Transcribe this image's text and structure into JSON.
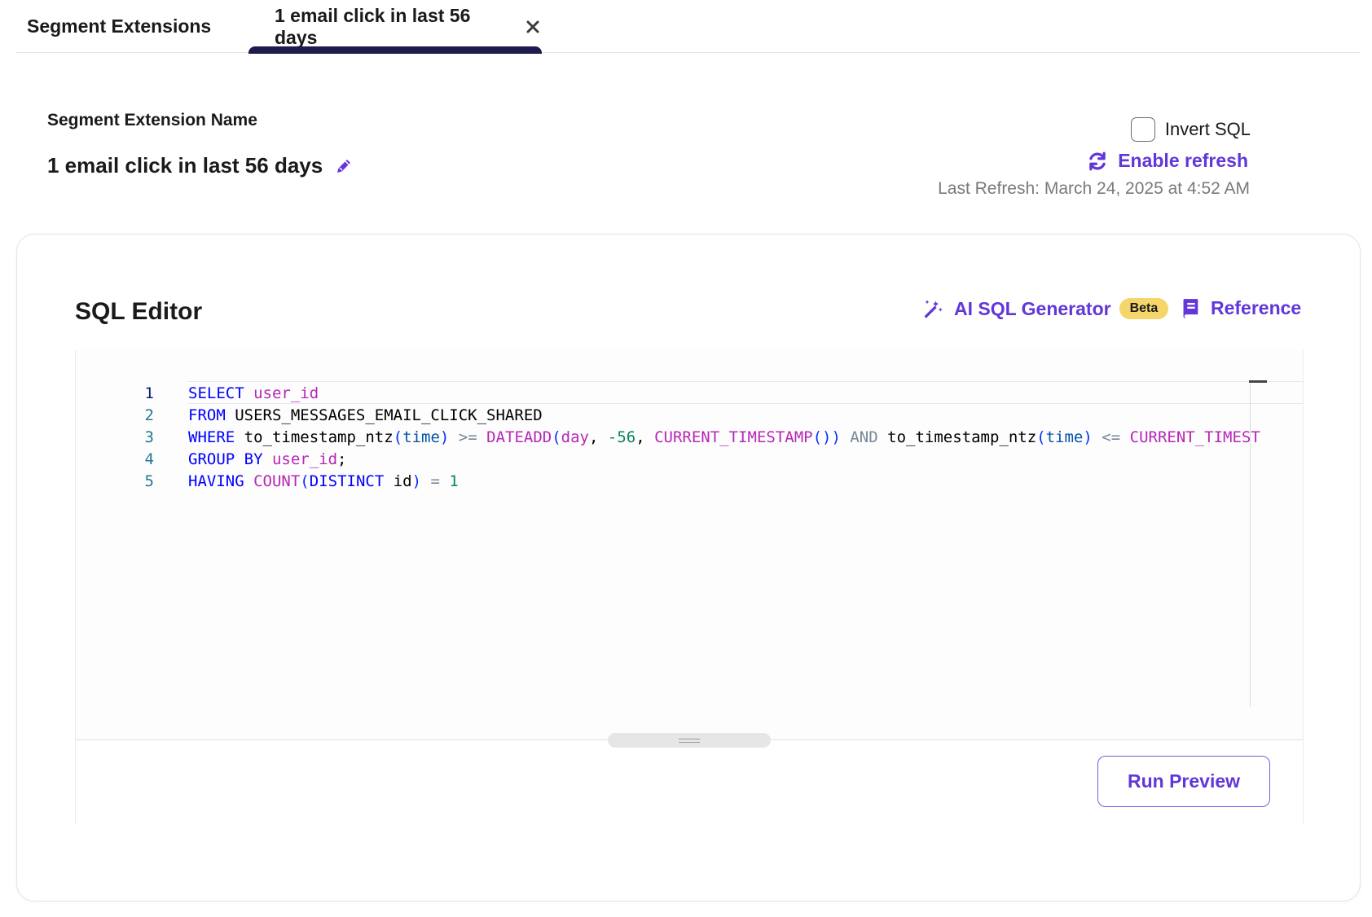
{
  "tabs": [
    {
      "label": "Segment Extensions"
    },
    {
      "label": "1 email click in last 56 days",
      "active": true
    }
  ],
  "header": {
    "name_label": "Segment Extension Name",
    "name_value": "1 email click in last 56 days",
    "invert_sql_label": "Invert SQL",
    "invert_sql_checked": false,
    "enable_refresh_label": "Enable refresh",
    "last_refresh": "Last Refresh: March 24, 2025 at 4:52 AM"
  },
  "editor": {
    "title": "SQL Editor",
    "ai_generator_label": "AI SQL Generator",
    "beta_badge": "Beta",
    "reference_label": "Reference",
    "line_numbers": [
      "1",
      "2",
      "3",
      "4",
      "5"
    ],
    "lines": [
      "SELECT user_id",
      "FROM USERS_MESSAGES_EMAIL_CLICK_SHARED",
      "WHERE to_timestamp_ntz(time) >= DATEADD(day, -56, CURRENT_TIMESTAMP()) AND to_timestamp_ntz(time) <= CURRENT_TIMEST",
      "GROUP BY user_id;",
      "HAVING COUNT(DISTINCT id) = 1"
    ],
    "run_preview_label": "Run Preview"
  },
  "colors": {
    "accent": "#6236d8",
    "tab_underline": "#1e1a4d",
    "beta_bg": "#f6d66b"
  }
}
